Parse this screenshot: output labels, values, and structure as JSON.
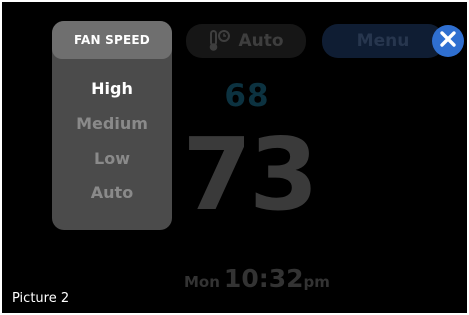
{
  "thermostat": {
    "mode_label": "Auto",
    "mode_icon": "thermometer-clock-icon",
    "menu_label": "Menu",
    "close_icon": "close-icon",
    "setpoint": "68",
    "current_temp": "73",
    "clock": {
      "day": "Mon",
      "time": "10:32",
      "ampm": "pm"
    }
  },
  "fan_speed": {
    "title": "FAN SPEED",
    "options": [
      {
        "label": "High",
        "selected": true
      },
      {
        "label": "Medium",
        "selected": false
      },
      {
        "label": "Low",
        "selected": false
      },
      {
        "label": "Auto",
        "selected": false
      }
    ]
  },
  "caption": "Picture 2",
  "colors": {
    "accent_blue": "#2f6fd0",
    "setpoint_teal": "#0c3240",
    "panel_bg": "#4b4b4b",
    "panel_header": "#6f6f6f"
  }
}
